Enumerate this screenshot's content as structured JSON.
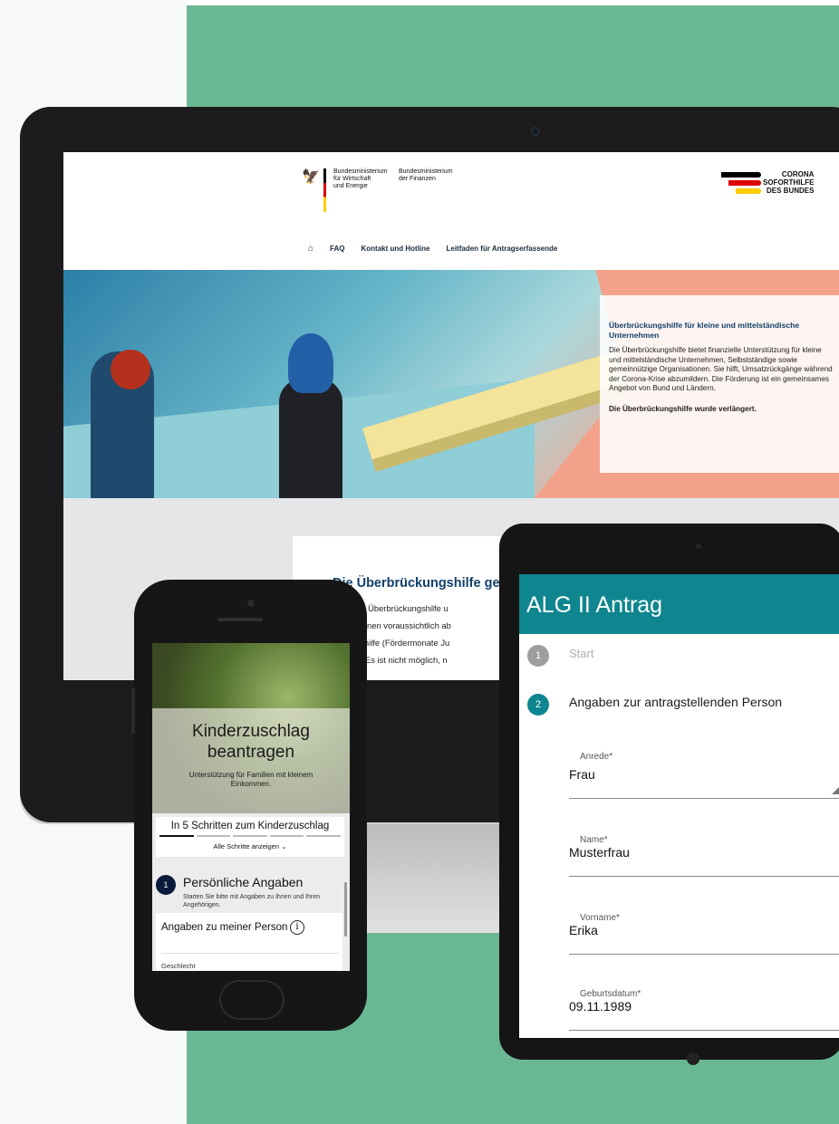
{
  "desktop": {
    "ministry_1": "Bundesministerium\nfür Wirtschaft\nund Energie",
    "ministry_2": "Bundesministerium\nder Finanzen",
    "corona_logo": "CORONA\nSOFORTHILFE\nDES BUNDES",
    "nav": [
      "FAQ",
      "Kontakt und Hotline",
      "Leitfaden für Antragserfassende"
    ],
    "hero_title": "Überbrückungshilfe für kleine und mittelständische Unternehmen",
    "hero_text": "Die Überbrückungshilfe bietet finanzielle Unterstützung für kleine und mittelständische Unternehmen, Selbstständige sowie gemeinnützige Organisationen. Sie hilft, Umsatzrückgänge während der Corona-Krise abzumildern. Die Förderung ist ein gemeinsames Angebot von Bund und Ländern.",
    "hero_strong": "Die Überbrückungshilfe wurde verlängert.",
    "content_title": "Die Überbrückungshilfe geh",
    "content_lines": [
      "hase der Überbrückungshilfe u",
      "hase können voraussichtlich ab",
      "ückungshilfe (Fördermonate Ju",
      "werden. Es ist nicht möglich, n"
    ]
  },
  "phone": {
    "title": "Kinderzuschlag\nbeantragen",
    "subtitle": "Unterstützung für Familien mit kleinem\nEinkommen.",
    "steps_title": "In 5 Schritten zum Kinderzuschlag",
    "steps_link": "Alle Schritte anzeigen",
    "step_number": "1",
    "step_title": "Persönliche Angaben",
    "step_desc": "Starten Sie bitte mit Angaben zu Ihnen und Ihren Angehörigen.",
    "card_title": "Angaben zu meiner Person",
    "card_field": "Geschlecht"
  },
  "tablet": {
    "title": "ALG II Antrag",
    "steps": [
      {
        "num": "1",
        "label": "Start"
      },
      {
        "num": "2",
        "label": "Angaben zur antragstellenden Person"
      }
    ],
    "fields": [
      {
        "label": "Anrede*",
        "value": "Frau"
      },
      {
        "label": "Name*",
        "value": "Musterfrau"
      },
      {
        "label": "Vorname*",
        "value": "Erika"
      },
      {
        "label": "Geburtsdatum*",
        "value": "09.11.1989"
      }
    ]
  },
  "colors": {
    "background_green": "#6ab893",
    "tablet_accent": "#0f868f",
    "desktop_heading": "#12406a"
  },
  "icons": [
    "eagle-icon",
    "home-icon",
    "chevron-down-icon",
    "info-icon",
    "dropdown-arrow-icon"
  ]
}
